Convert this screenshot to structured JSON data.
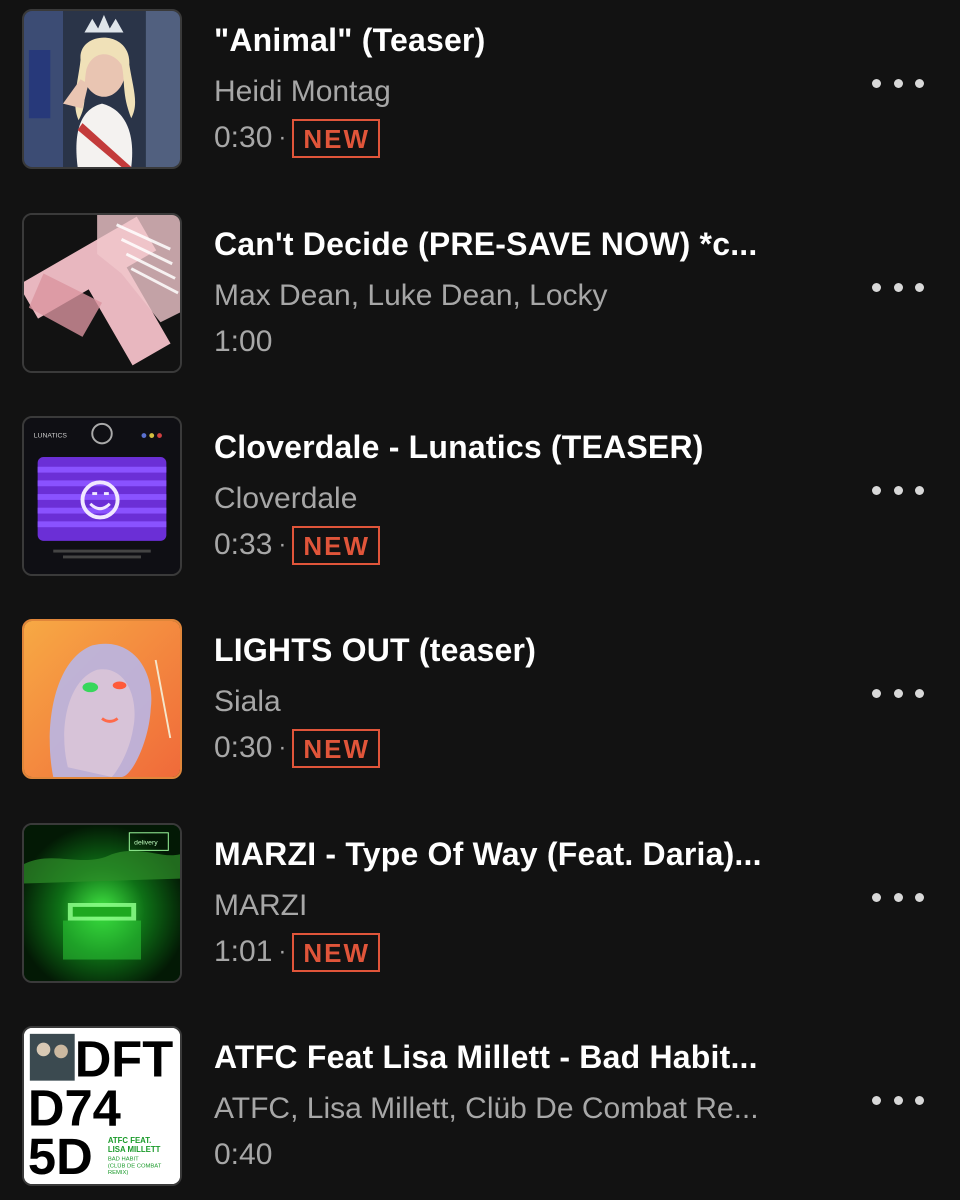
{
  "tracks": [
    {
      "title": "\"Animal\" (Teaser)",
      "artist": "Heidi Montag",
      "duration": "0:30",
      "badge": "NEW",
      "artwork": "crown-portrait-artwork"
    },
    {
      "title": "Can't Decide (PRE-SAVE NOW) *c...",
      "artist": "Max Dean, Luke Dean, Locky",
      "duration": "1:00",
      "badge": "",
      "artwork": "pink-cross-artwork"
    },
    {
      "title": "Cloverdale - Lunatics (TEASER)",
      "artist": "Cloverdale",
      "duration": "0:33",
      "badge": "NEW",
      "artwork": "purple-smiley-tv-artwork",
      "artwork_text": "LUNATICS"
    },
    {
      "title": "LIGHTS OUT (teaser)",
      "artist": "Siala",
      "duration": "0:30",
      "badge": "NEW",
      "artwork": "orange-face-artwork"
    },
    {
      "title": "MARZI - Type Of Way (Feat. Daria)...",
      "artist": "MARZI",
      "duration": "1:01",
      "badge": "NEW",
      "artwork": "green-building-artwork",
      "artwork_text": "delivery"
    },
    {
      "title": "ATFC Feat Lisa Millett  - Bad Habit...",
      "artist": "ATFC, Lisa Millett, Clüb De Combat Re...",
      "duration": "0:40",
      "badge": "",
      "artwork": "dft-logo-artwork",
      "artwork_text": {
        "line1": "DFT",
        "line2": "D74",
        "line3": "5D",
        "caption1": "ATFC FEAT.",
        "caption2": "LISA MILLETT",
        "caption3": "BAD HABIT",
        "caption4": "(CLÜB DE COMBAT",
        "caption5": "REMIX)"
      }
    }
  ],
  "separator": "·",
  "more_icon": "more-horizontal-icon",
  "colors": {
    "background": "#121212",
    "title": "#ffffff",
    "secondary": "#a7a7a7",
    "badge": "#e0553a"
  }
}
